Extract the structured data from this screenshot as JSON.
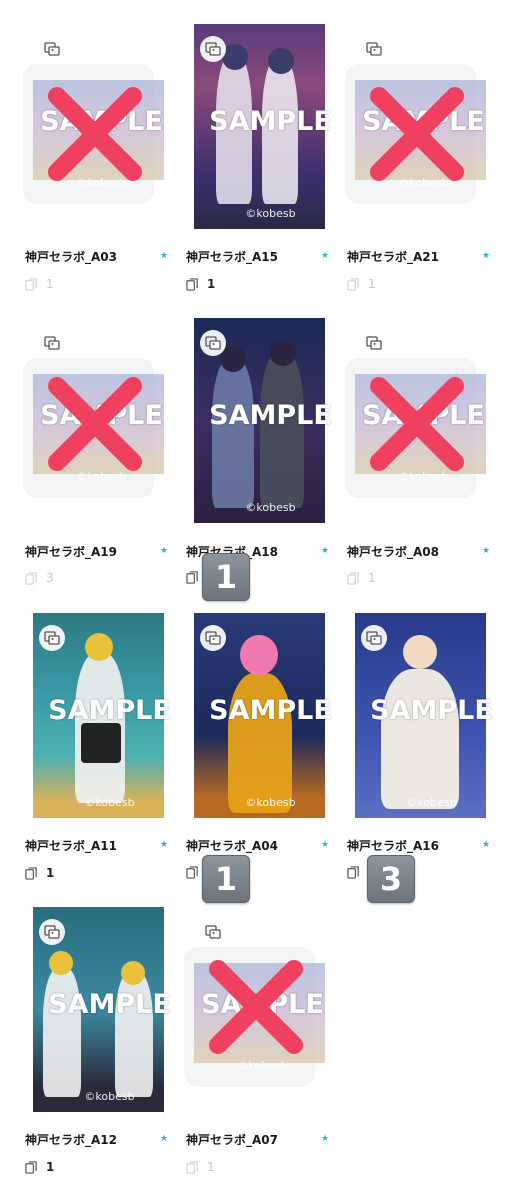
{
  "sample_text": "SAMPLE",
  "copyright_text": "©kobesb",
  "items": [
    {
      "title": "神戸セラボ_A03",
      "count": "1",
      "sold_out": true
    },
    {
      "title": "神戸セラボ_A15",
      "count": "1",
      "sold_out": false
    },
    {
      "title": "神戸セラボ_A21",
      "count": "1",
      "sold_out": true
    },
    {
      "title": "神戸セラボ_A19",
      "count": "3",
      "sold_out": true
    },
    {
      "title": "神戸セラボ_A18",
      "count": "",
      "sold_out": false
    },
    {
      "title": "神戸セラボ_A08",
      "count": "1",
      "sold_out": true
    },
    {
      "title": "神戸セラボ_A11",
      "count": "1",
      "sold_out": false
    },
    {
      "title": "神戸セラボ_A04",
      "count": "",
      "sold_out": false
    },
    {
      "title": "神戸セラボ_A16",
      "count": "",
      "sold_out": false
    },
    {
      "title": "神戸セラボ_A12",
      "count": "1",
      "sold_out": false
    },
    {
      "title": "神戸セラボ_A07",
      "count": "1",
      "sold_out": true
    }
  ],
  "overlay_badges": [
    {
      "value": "1"
    },
    {
      "value": "1"
    },
    {
      "value": "3"
    }
  ],
  "star_glyph": "★",
  "colors": {
    "accent": "#2bb6c4",
    "cross": "#f0405f",
    "badge": "#7a8087"
  },
  "icons": {
    "image_badge": "image-badge-icon",
    "card_count": "card-stack-icon",
    "sold_out": "red-cross-icon"
  }
}
